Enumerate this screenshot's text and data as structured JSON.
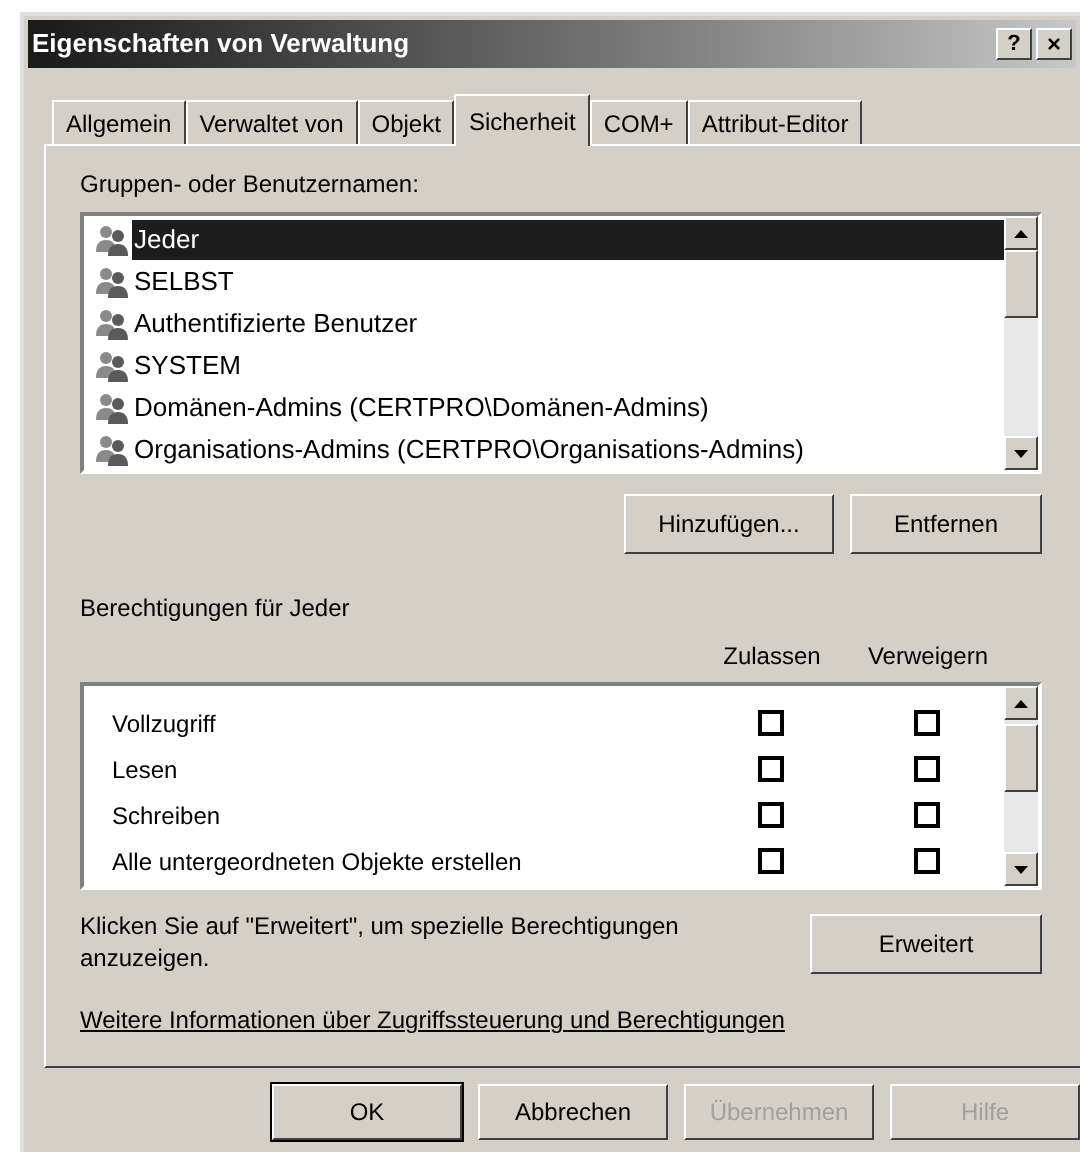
{
  "window": {
    "title": "Eigenschaften von Verwaltung",
    "help_button": "?",
    "close_button": "×"
  },
  "tabs": [
    {
      "label": "Allgemein",
      "selected": false
    },
    {
      "label": "Verwaltet von",
      "selected": false
    },
    {
      "label": "Objekt",
      "selected": false
    },
    {
      "label": "Sicherheit",
      "selected": true
    },
    {
      "label": "COM+",
      "selected": false
    },
    {
      "label": "Attribut-Editor",
      "selected": false
    }
  ],
  "groups": {
    "label": "Gruppen- oder Benutzernamen:",
    "items": [
      {
        "name": "Jeder",
        "selected": true
      },
      {
        "name": "SELBST",
        "selected": false
      },
      {
        "name": "Authentifizierte Benutzer",
        "selected": false
      },
      {
        "name": "SYSTEM",
        "selected": false
      },
      {
        "name": "Domänen-Admins (CERTPRO\\Domänen-Admins)",
        "selected": false
      },
      {
        "name": "Organisations-Admins (CERTPRO\\Organisations-Admins)",
        "selected": false
      }
    ],
    "buttons": [
      "Hinzufügen...",
      "Entfernen"
    ]
  },
  "permissions": {
    "label": "Berechtigungen für Jeder",
    "columns": [
      "Zulassen",
      "Verweigern"
    ],
    "rows": [
      {
        "name": "Vollzugriff",
        "allow": false,
        "deny": false
      },
      {
        "name": "Lesen",
        "allow": false,
        "deny": false
      },
      {
        "name": "Schreiben",
        "allow": false,
        "deny": false
      },
      {
        "name": "Alle untergeordneten Objekte erstellen",
        "allow": false,
        "deny": false
      }
    ]
  },
  "advanced": {
    "text": "Klicken Sie auf \"Erweitert\", um spezielle Berechtigungen anzuzeigen.",
    "button": "Erweitert"
  },
  "link": "Weitere Informationen über Zugriffssteuerung und Berechtigungen",
  "buttons": [
    {
      "label": "OK",
      "disabled": false,
      "default": true
    },
    {
      "label": "Abbrechen",
      "disabled": false,
      "default": false
    },
    {
      "label": "Übernehmen",
      "disabled": true,
      "default": false
    },
    {
      "label": "Hilfe",
      "disabled": true,
      "default": false
    }
  ]
}
